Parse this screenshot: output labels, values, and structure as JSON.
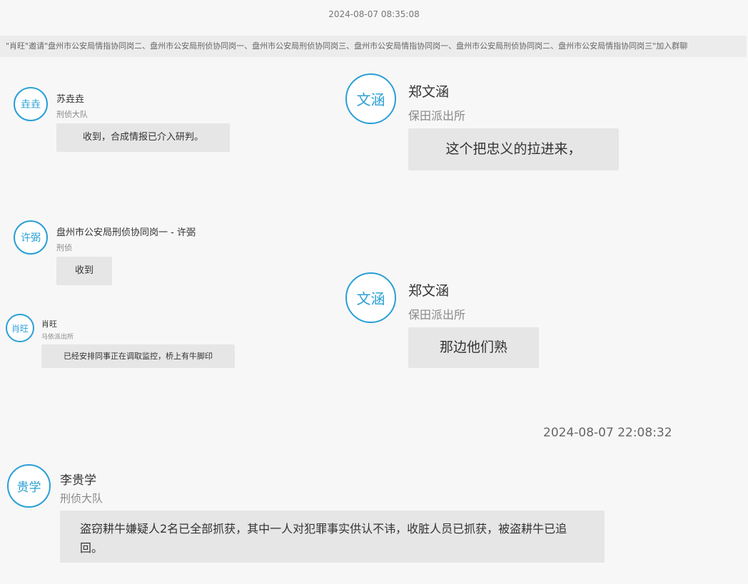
{
  "timestamps": {
    "top": "2024-08-07 08:35:08",
    "mid": "2024-08-07 22:08:32"
  },
  "system_notice": "\"肖旺\"邀请\"盘州市公安局情指协同岗二、盘州市公安局刑侦协同岗一、盘州市公安局刑侦协同岗三、盘州市公安局情指协同岗一、盘州市公安局刑侦协同岗二、盘州市公安局情指协同岗三\"加入群聊",
  "messages": [
    {
      "avatar": "垚垚",
      "name": "苏垚垚",
      "dept": "刑侦大队",
      "text": "收到，合成情报已介入研判。"
    },
    {
      "avatar": "文涵",
      "name": "郑文涵",
      "dept": "保田派出所",
      "text": "这个把忠义的拉进来，"
    },
    {
      "avatar": "许弼",
      "name": "盘州市公安局刑侦协同岗一 - 许弼",
      "dept": "刑侦",
      "text": "收到"
    },
    {
      "avatar": "文涵",
      "name": "郑文涵",
      "dept": "保田派出所",
      "text": "那边他们熟"
    },
    {
      "avatar": "肖旺",
      "name": "肖旺",
      "dept": "马依派出所",
      "text": "已经安排同事正在调取监控，桥上有牛脚印"
    },
    {
      "avatar": "贵学",
      "name": "李贵学",
      "dept": "刑侦大队",
      "text": "盗窃耕牛嫌疑人2名已全部抓获，其中一人对犯罪事实供认不讳，收脏人员已抓获，被盗耕牛已追回。"
    }
  ],
  "colors": {
    "accent": "#2a9fd6",
    "bubble": "#e6e6e6",
    "background": "#f7f7f7"
  }
}
